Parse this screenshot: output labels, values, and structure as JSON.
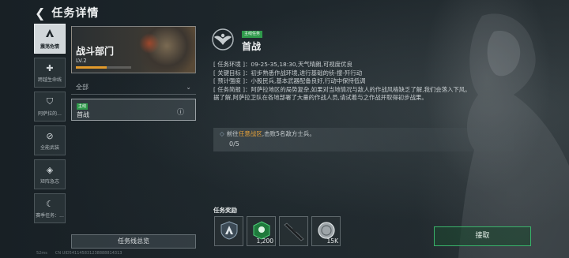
{
  "header": {
    "title": "任务详情"
  },
  "sidebar": {
    "items": [
      {
        "label": "震荡危情",
        "icon": "squad-a-icon",
        "active": true
      },
      {
        "label": "跨越生命线",
        "icon": "plus-icon",
        "active": false
      },
      {
        "label": "阿萨拉的...",
        "icon": "shield-icon",
        "active": false
      },
      {
        "label": "全能武装",
        "icon": "slash-circle-icon",
        "active": false
      },
      {
        "label": "矩阵急志",
        "icon": "diamond-icon",
        "active": false
      },
      {
        "label": "赛季任务：...",
        "icon": "sickle-icon",
        "active": false
      }
    ]
  },
  "card": {
    "name": "战斗部门",
    "level": "LV.2",
    "progress": 0.55
  },
  "filter": {
    "selected": "全部"
  },
  "task_list": [
    {
      "tag": "主线",
      "name": "首战"
    }
  ],
  "overview_button": "任务线总览",
  "footer": {
    "signal": "52ms",
    "uid": "CN UID541145831238888814313"
  },
  "mission": {
    "tag": "主线任务",
    "name": "首战",
    "info": [
      {
        "key": "[ 任务环境 ]",
        "value": "：09-25-35,18:30,天气晴朗,可视度优良"
      },
      {
        "key": "[ 关键目标 ]",
        "value": "：初步熟悉作战环境,进行基础的侦-搜-歼行动"
      },
      {
        "key": "[ 预计强度 ]",
        "value": "：小股民兵,基本武器配备良好,行动中保持低调"
      },
      {
        "key": "[ 任务简报 ]",
        "value": "：阿萨拉地区的局势复杂,如果对当地情况与敌人的作战风格缺乏了解,我们会落入下风。"
      }
    ],
    "info_extra": "据了解,阿萨拉卫队在各地部署了大量的作战人员,请试着与之作战并取得初步战果。",
    "objective": {
      "prefix": "前往",
      "highlight": "任意战区",
      "suffix": ",击败5名敌方士兵。",
      "progress": "0/5"
    }
  },
  "rewards": {
    "label": "任务奖励",
    "items": [
      {
        "icon": "squad-badge-icon",
        "count": ""
      },
      {
        "icon": "green-badge-icon",
        "count": "1,200"
      },
      {
        "icon": "rifle-icon",
        "count": ""
      },
      {
        "icon": "coin-icon",
        "count": "15K"
      }
    ]
  },
  "claim_button": "接取",
  "colors": {
    "accent_green": "#2f9a4b",
    "highlight": "#e6a23a",
    "progress_orange": "#e39a2b"
  }
}
